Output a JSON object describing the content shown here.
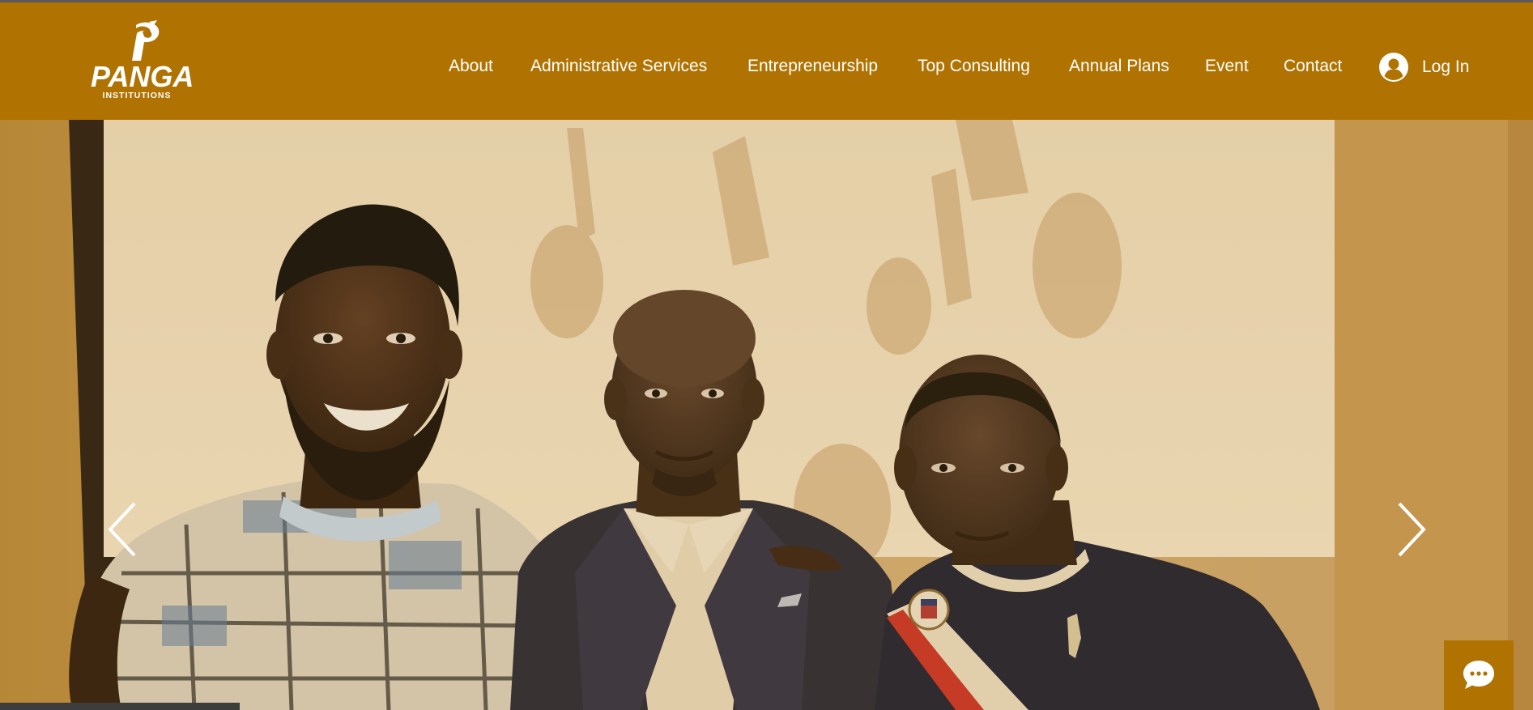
{
  "logo": {
    "word": "PANGA",
    "sub": "INSTITUTIONS"
  },
  "nav": {
    "items": [
      {
        "label": "About"
      },
      {
        "label": "Administrative Services"
      },
      {
        "label": "Entrepreneurship"
      },
      {
        "label": "Top Consulting"
      },
      {
        "label": "Annual Plans"
      },
      {
        "label": "Event"
      },
      {
        "label": "Contact"
      }
    ]
  },
  "login": {
    "label": "Log In",
    "icon": "user-avatar-icon"
  },
  "slideshow": {
    "prev_icon": "chevron-left-icon",
    "next_icon": "chevron-right-icon"
  },
  "chat": {
    "icon": "chat-bubble-icon"
  },
  "colors": {
    "header_bg": "#b07302",
    "text": "#ffffff",
    "chat_bg": "#b07302"
  }
}
